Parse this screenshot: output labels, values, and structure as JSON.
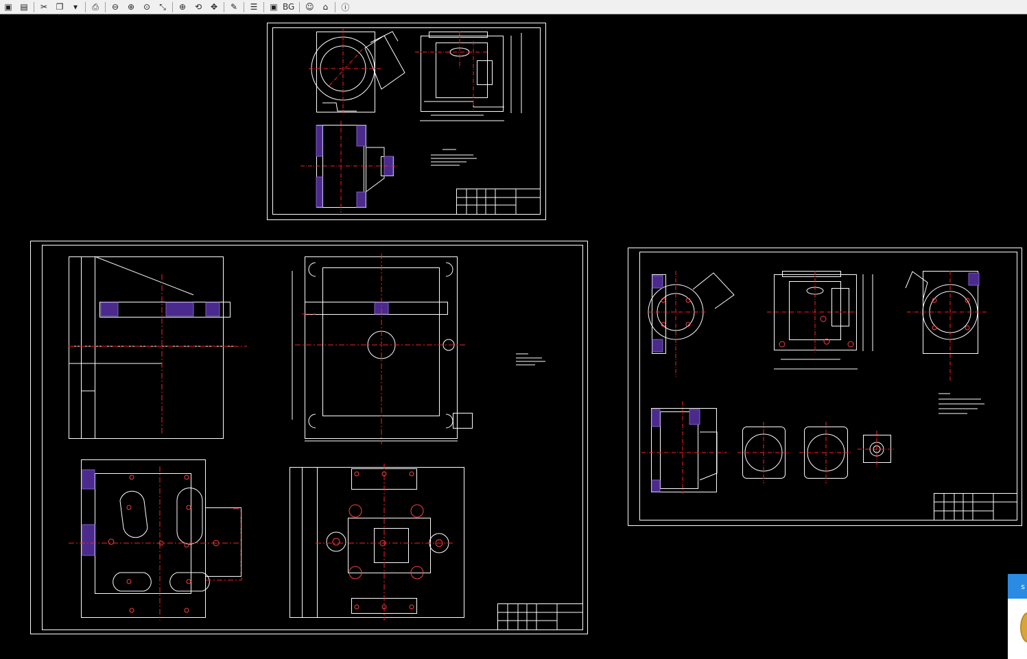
{
  "toolbar": {
    "buttons": [
      {
        "name": "save-icon",
        "glyph": "▣"
      },
      {
        "name": "pdf-export-icon",
        "glyph": "▤"
      },
      {
        "name": "print-settings-icon",
        "glyph": "✂"
      },
      {
        "name": "layout-icon",
        "glyph": "❐"
      },
      {
        "name": "dropdown-arrow-icon",
        "glyph": "▾"
      },
      {
        "name": "print-icon",
        "glyph": "⎙"
      },
      {
        "name": "zoom-out-icon",
        "glyph": "⊖"
      },
      {
        "name": "zoom-in-icon",
        "glyph": "⊕"
      },
      {
        "name": "zoom-window-icon",
        "glyph": "⊙"
      },
      {
        "name": "zoom-realtime-icon",
        "glyph": "⤡"
      },
      {
        "name": "zoom-extents-icon",
        "glyph": "⊕"
      },
      {
        "name": "zoom-previous-icon",
        "glyph": "⟲"
      },
      {
        "name": "pan-icon",
        "glyph": "✥"
      },
      {
        "name": "measure-icon",
        "glyph": "✎"
      },
      {
        "name": "layers-icon",
        "glyph": "☰"
      },
      {
        "name": "model-space-icon",
        "glyph": "▣"
      }
    ],
    "bg_label": "BG",
    "tail_buttons": [
      {
        "name": "user-icon",
        "glyph": "☺"
      },
      {
        "name": "home-icon",
        "glyph": "⌂"
      },
      {
        "name": "info-icon",
        "glyph": "ⓘ"
      }
    ]
  },
  "side_tab": {
    "label": "s"
  },
  "colors": {
    "background": "#000000",
    "line": "#ffffff",
    "centerline": "#ff2020",
    "hatch": "#4a2a8c",
    "toolbar": "#f0f0f0"
  }
}
